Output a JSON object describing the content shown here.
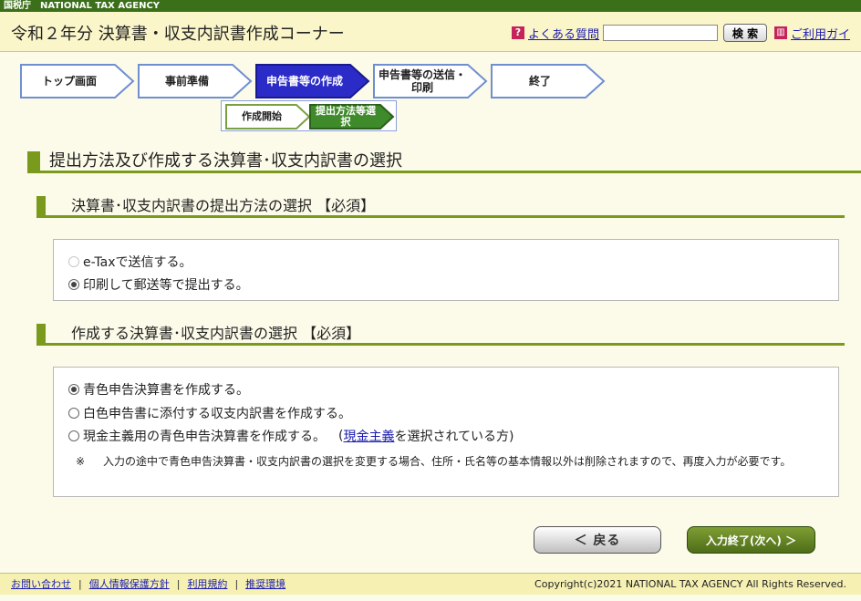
{
  "agency_bar": {
    "jp": "国税庁",
    "en": "NATIONAL TAX AGENCY"
  },
  "header": {
    "title": "令和２年分 決算書・収支内訳書作成コーナー",
    "faq_icon": "question-icon",
    "faq_label": "よくある質問",
    "search_placeholder": "",
    "search_button": "検 索",
    "guide_icon": "book-icon",
    "guide_label": "ご利用ガイ"
  },
  "steps": [
    {
      "label": "トップ画面",
      "active": false
    },
    {
      "label": "事前準備",
      "active": false
    },
    {
      "label": "申告書等の作成",
      "active": true
    },
    {
      "label": "申告書等の送信・印刷",
      "active": false
    },
    {
      "label": "終了",
      "active": false
    }
  ],
  "substeps": [
    {
      "label": "作成開始",
      "active": false
    },
    {
      "label": "提出方法等選択",
      "active": true
    }
  ],
  "page_title": "提出方法及び作成する決算書･収支内訳書の選択",
  "section1": {
    "heading": "決算書･収支内訳書の提出方法の選択 【必須】",
    "options": [
      {
        "label": "e-Taxで送信する。",
        "checked": false,
        "disabled": true
      },
      {
        "label": "印刷して郵送等で提出する。",
        "checked": true,
        "disabled": false
      }
    ]
  },
  "section2": {
    "heading": "作成する決算書･収支内訳書の選択 【必須】",
    "options": [
      {
        "label": "青色申告決算書を作成する。",
        "checked": true
      },
      {
        "label": "白色申告書に添付する収支内訳書を作成する。",
        "checked": false
      },
      {
        "label": "現金主義用の青色申告決算書を作成する。",
        "checked": false
      }
    ],
    "option3_suffix_open": "(",
    "option3_link": "現金主義",
    "option3_suffix_close": "を選択されている方)",
    "note_mark": "※",
    "note_text": "入力の途中で青色申告決算書・収支内訳書の選択を変更する場合、住所・氏名等の基本情報以外は削除されますので、再度入力が必要です。"
  },
  "buttons": {
    "back": "＜ 戻る",
    "next": "入力終了(次へ) ＞"
  },
  "footer": {
    "links": [
      "お問い合わせ",
      "個人情報保護方針",
      "利用規約",
      "推奨環境"
    ],
    "copyright": "Copyright(c)2021 NATIONAL TAX AGENCY All Rights Reserved."
  },
  "colors": {
    "agency_bar": "#3b6f1a",
    "accent_green": "#7a9a1e",
    "step_active": "#2b2bc8",
    "substep_active": "#3f8a2a",
    "link": "#1a1ab0"
  }
}
